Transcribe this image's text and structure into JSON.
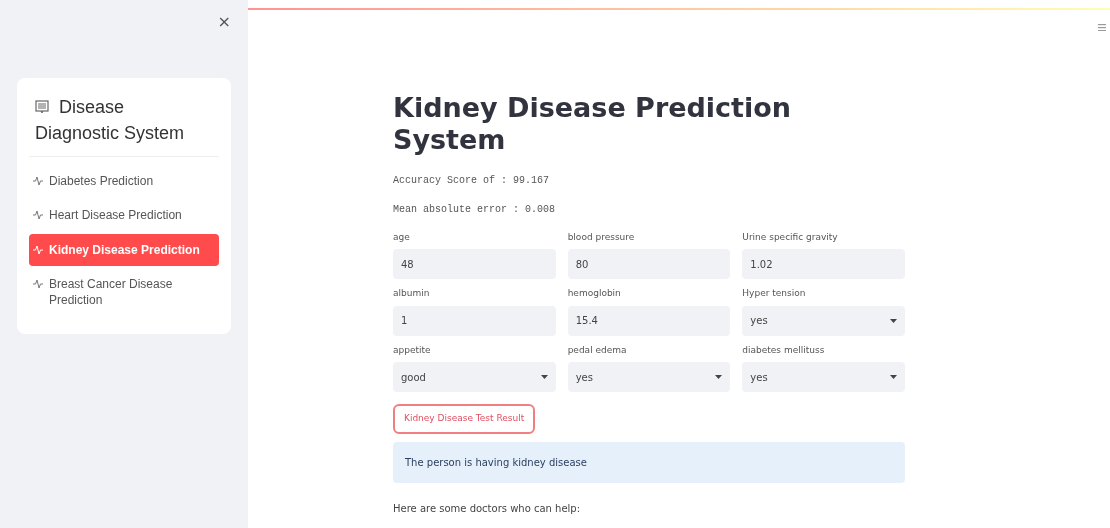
{
  "sidebar": {
    "close": "×",
    "title": "Disease Diagnostic System",
    "items": [
      {
        "label": "Diabetes Prediction",
        "selected": false
      },
      {
        "label": "Heart Disease Prediction",
        "selected": false
      },
      {
        "label": "Kidney Disease Prediction",
        "selected": true
      },
      {
        "label": "Breast Cancer Disease Prediction",
        "selected": false
      }
    ]
  },
  "main": {
    "title": "Kidney Disease Prediction System",
    "metrics": [
      "Accuracy Score of : 99.167",
      "Mean absolute error : 0.008"
    ],
    "fields": [
      {
        "kind": "text",
        "label": "age",
        "value": "48"
      },
      {
        "kind": "text",
        "label": "blood pressure",
        "value": "80"
      },
      {
        "kind": "text",
        "label": "Urine specific gravity",
        "value": "1.02"
      },
      {
        "kind": "text",
        "label": "albumin",
        "value": "1"
      },
      {
        "kind": "text",
        "label": "hemoglobin",
        "value": "15.4"
      },
      {
        "kind": "select",
        "label": "Hyper tension",
        "value": "yes"
      },
      {
        "kind": "select",
        "label": "appetite",
        "value": "good"
      },
      {
        "kind": "select",
        "label": "pedal edema",
        "value": "yes"
      },
      {
        "kind": "select",
        "label": "diabetes mellituss",
        "value": "yes"
      }
    ],
    "button": "Kidney Disease Test Result",
    "result": "The person is having kidney disease",
    "note": "Here are some doctors who can help:"
  }
}
